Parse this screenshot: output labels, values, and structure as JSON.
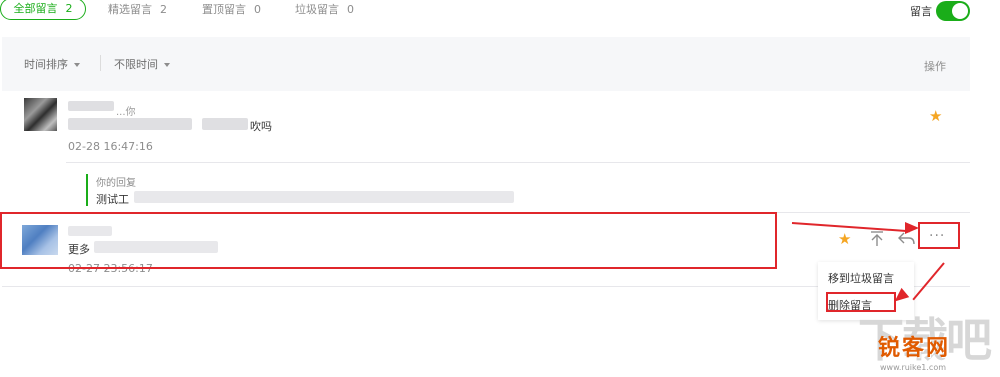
{
  "tabs": {
    "all": {
      "label": "全部留言",
      "count": "2"
    },
    "featured": {
      "label": "精选留言",
      "count": "2"
    },
    "pinned": {
      "label": "置顶留言",
      "count": "0"
    },
    "spam": {
      "label": "垃圾留言",
      "count": "0"
    }
  },
  "toggle": {
    "label": "留言",
    "state": "on"
  },
  "filters": {
    "sort_label": "时间排序",
    "range_label": "不限时间",
    "ops_header": "操作"
  },
  "comments": [
    {
      "name_fragment": "...你",
      "content_fragment": "吹吗",
      "time": "02-28 16:47:16",
      "reply": {
        "title": "你的回复",
        "text_prefix": "测试工"
      }
    },
    {
      "content_prefix": "更多",
      "time": "02-27 23:56:17"
    }
  ],
  "menu": {
    "move_to_spam": "移到垃圾留言",
    "delete": "删除留言"
  },
  "watermark": {
    "big": "下载吧",
    "brand": "锐客网",
    "url": "www.ruike1.com"
  },
  "colors": {
    "accent": "#1aad19",
    "star": "#f5a623",
    "annotation": "#e0262b"
  }
}
